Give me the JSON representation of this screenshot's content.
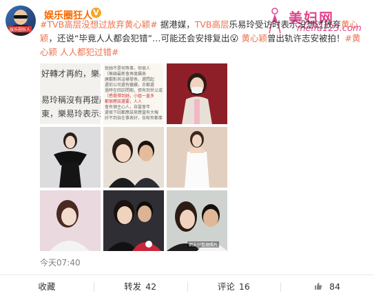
{
  "account": {
    "name": "娱乐圈狂人",
    "verified_badge": "V",
    "avatar_tag": "娱乐圈狂人"
  },
  "watermark": {
    "cn": "美妇网",
    "url": "meifu123.com"
  },
  "post": {
    "segments": [
      {
        "type": "tag",
        "text": "#TVB高层没想过放弃黄心颖#"
      },
      {
        "type": "text",
        "text": " 据港媒，"
      },
      {
        "type": "tag",
        "text": "TVB高层"
      },
      {
        "type": "text",
        "text": "乐易玲受访时表示"
      },
      {
        "type": "text",
        "text": "没想过放弃"
      },
      {
        "type": "tag",
        "text": "黄心颖"
      },
      {
        "type": "text",
        "text": "，还说"
      },
      {
        "type": "text",
        "text": "“毕竟人人都会犯错”…可能还会安排复出"
      },
      {
        "type": "emoji",
        "text": "😮"
      },
      {
        "type": "text",
        "text": " "
      },
      {
        "type": "name",
        "text": "黄心颖"
      },
      {
        "type": "text",
        "text": "曾出轨许志安被拍！"
      },
      {
        "type": "tag",
        "text": "#黄心颖 人人都犯过错#"
      }
    ],
    "time": "今天07:40"
  },
  "images": [
    {
      "label": "news-text-image",
      "lines": [
        "好轉才再約，樂易",
        "易玲稱沒有再提起",
        "東，樂易玲表示未"
      ]
    },
    {
      "label": "news-text-and-photo",
      "lines": [
        "就她不是何等事，但很人",
        "（無線最新會再度續表",
        "唐觀對其這樣發表，還問起",
        "還前公司還有繼續，亦都還",
        "過時在回訪問期，張有到世父或",
        "（感覺得到她，小姐一直多",
        "都很應該還要，人人",
        "會有個主心人，自當會年",
        "還很下因都應該來應當有大報",
        "好不到自在事表好，告呢有都事"
      ]
    },
    {
      "label": "woman-with-mask"
    },
    {
      "label": "woman-black-dress"
    },
    {
      "label": "couple-selfie-1"
    },
    {
      "label": "woman-white-dress"
    },
    {
      "label": "woman-portrait"
    },
    {
      "label": "couple-selfie-2"
    },
    {
      "label": "couple-selfie-3",
      "caption": "網友好整理照片"
    }
  ],
  "actions": {
    "favorite": {
      "label": "收藏"
    },
    "repost": {
      "label": "转发",
      "count": "42"
    },
    "comment": {
      "label": "评论",
      "count": "16"
    },
    "like": {
      "count": "84"
    }
  }
}
